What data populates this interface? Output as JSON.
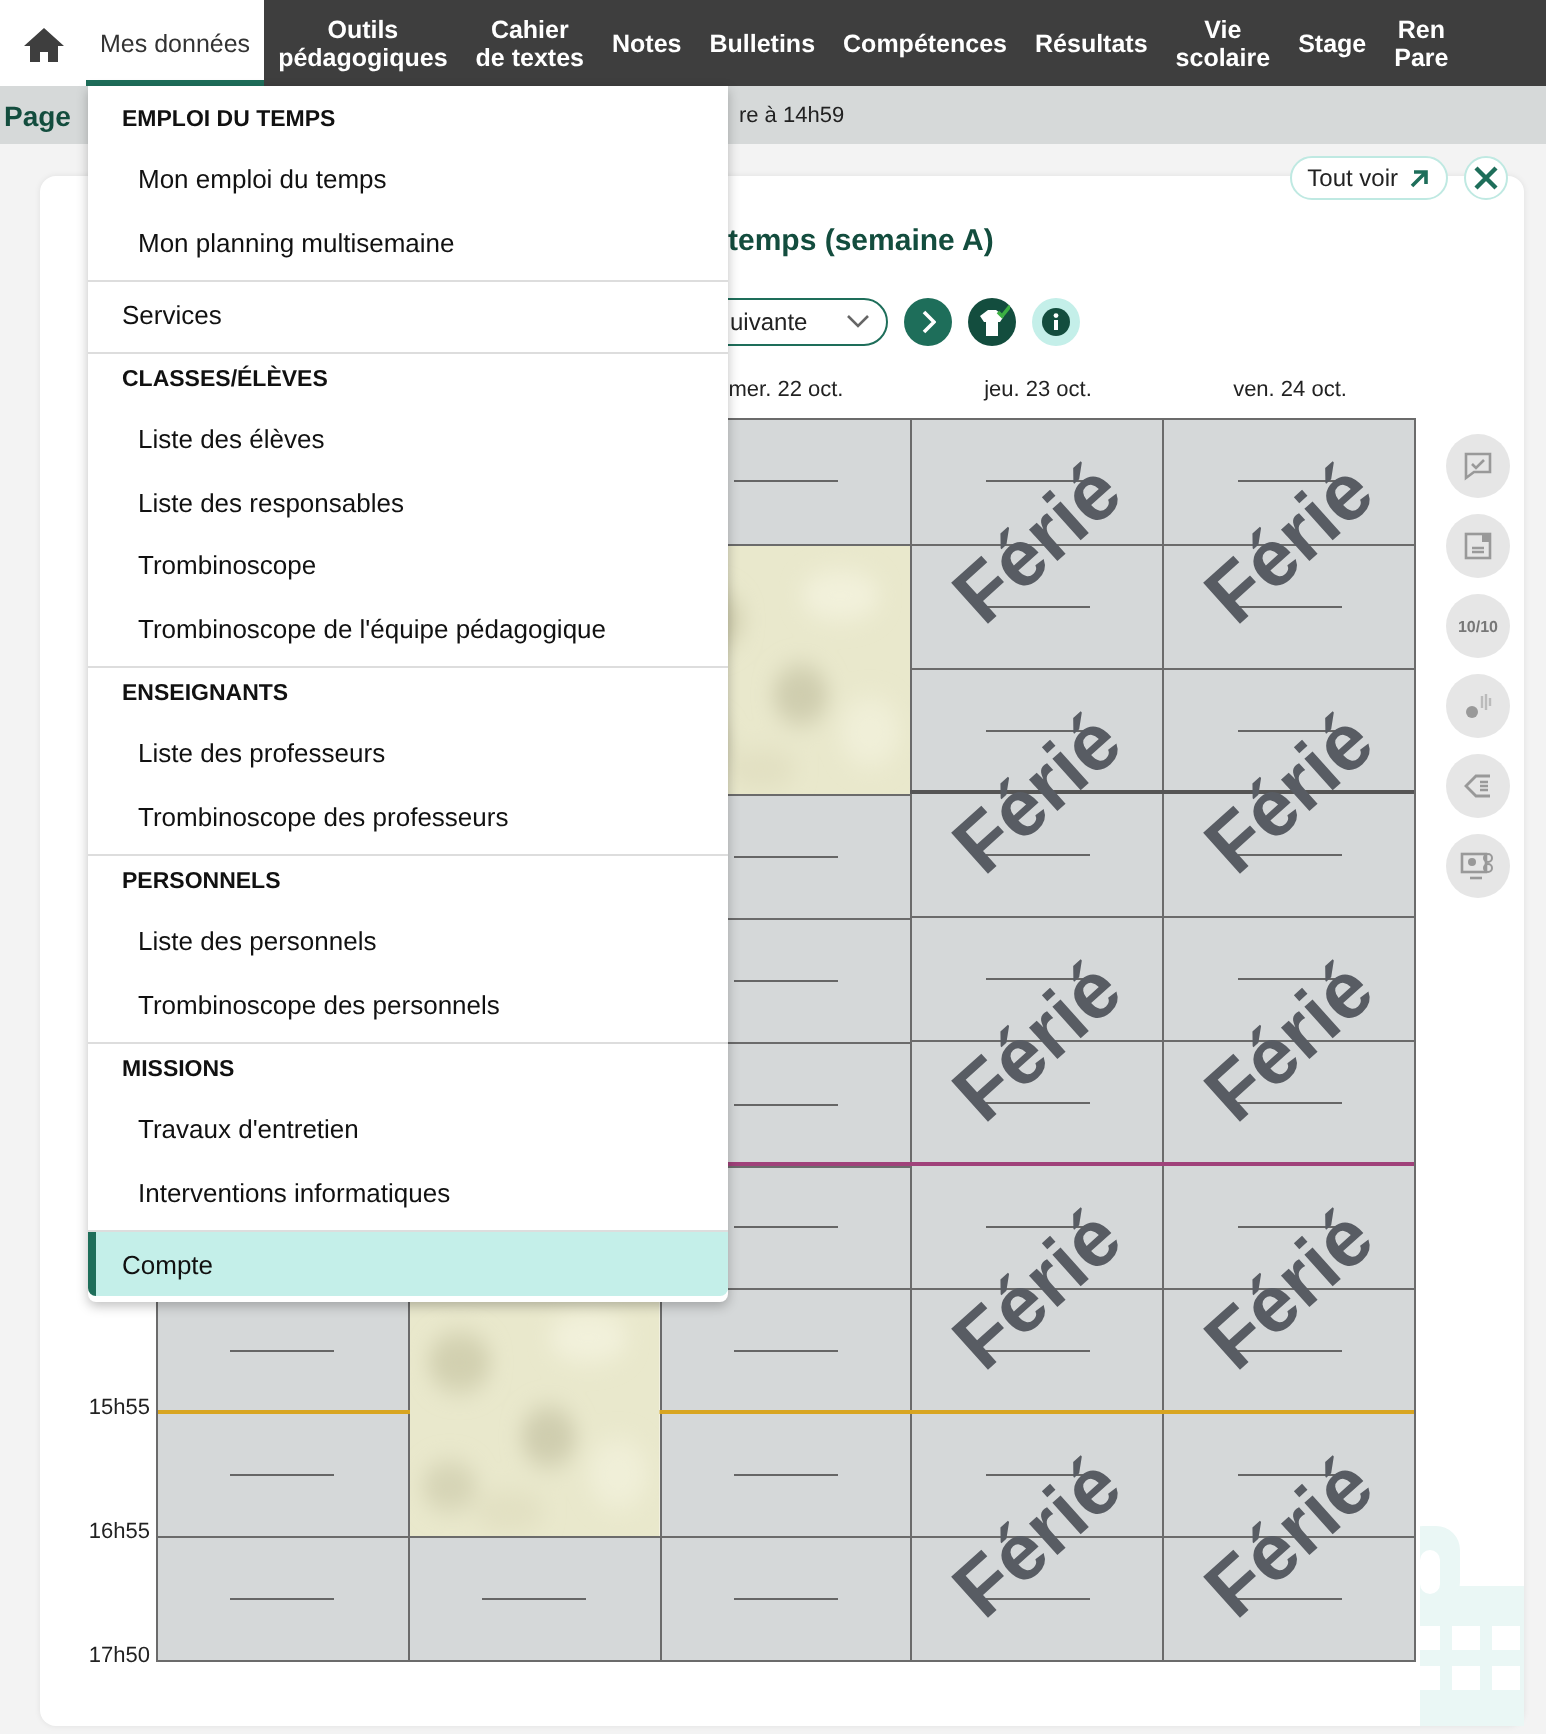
{
  "nav": {
    "tabs": [
      {
        "label": "Mes données",
        "selected": true
      },
      {
        "label": "Outils\npédagogiques",
        "selected": false
      },
      {
        "label": "Cahier\nde textes",
        "selected": false
      },
      {
        "label": "Notes",
        "selected": false
      },
      {
        "label": "Bulletins",
        "selected": false
      },
      {
        "label": "Compétences",
        "selected": false
      },
      {
        "label": "Résultats",
        "selected": false
      },
      {
        "label": "Vie\nscolaire",
        "selected": false
      },
      {
        "label": "Stage",
        "selected": false
      },
      {
        "label": "Ren\nPare",
        "selected": false
      }
    ]
  },
  "subheader": {
    "title": "Page",
    "info": "re à 14h59"
  },
  "menu": [
    {
      "kind": "group",
      "header": "EMPLOI DU TEMPS",
      "items": [
        {
          "label": "Mon emploi du temps",
          "selected": false
        },
        {
          "label": "Mon planning multisemaine",
          "selected": false
        }
      ]
    },
    {
      "kind": "link",
      "label": "Services",
      "selected": false
    },
    {
      "kind": "group",
      "header": "CLASSES/ÉLÈVES",
      "items": [
        {
          "label": "Liste des élèves",
          "selected": false
        },
        {
          "label": "Liste des responsables",
          "selected": false
        },
        {
          "label": "Trombinoscope",
          "selected": false
        },
        {
          "label": "Trombinoscope de l'équipe pédagogique",
          "selected": false
        }
      ]
    },
    {
      "kind": "group",
      "header": "ENSEIGNANTS",
      "items": [
        {
          "label": "Liste des professeurs",
          "selected": false
        },
        {
          "label": "Trombinoscope des professeurs",
          "selected": false
        }
      ]
    },
    {
      "kind": "group",
      "header": "PERSONNELS",
      "items": [
        {
          "label": "Liste des personnels",
          "selected": false
        },
        {
          "label": "Trombinoscope des personnels",
          "selected": false
        }
      ]
    },
    {
      "kind": "group",
      "header": "MISSIONS",
      "items": [
        {
          "label": "Travaux d'entretien",
          "selected": false
        },
        {
          "label": "Interventions informatiques",
          "selected": false
        }
      ]
    },
    {
      "kind": "link",
      "label": "Compte",
      "selected": true
    }
  ],
  "panel": {
    "see_all": "Tout voir",
    "title": "temps (semaine A)",
    "week_select": "uivante",
    "tools": [
      {
        "kind": "comment"
      },
      {
        "kind": "note"
      },
      {
        "kind": "grade",
        "label": "10/10"
      },
      {
        "kind": "sound"
      },
      {
        "kind": "tag"
      },
      {
        "kind": "screen"
      }
    ],
    "timetable": {
      "end_time": "17h50",
      "rows": [
        {},
        {},
        {},
        {
          "color": "#555555"
        },
        {},
        {},
        {
          "color": "#a0417a"
        },
        {},
        {
          "color": "#d8a521",
          "time": "15h55"
        },
        {
          "time": "16h55"
        }
      ],
      "columns": [
        {
          "slots": [
            {
              "kind": "hidden"
            },
            {
              "kind": "hidden"
            },
            {
              "kind": "hidden"
            },
            {
              "kind": "hidden"
            },
            {
              "kind": "hidden"
            },
            {
              "kind": "hidden"
            },
            {
              "kind": "hidden"
            },
            {
              "kind": "free"
            },
            {
              "kind": "free"
            },
            {
              "kind": "free"
            }
          ]
        },
        {
          "slots": [
            {
              "kind": "hidden"
            },
            {
              "kind": "hidden"
            },
            {
              "kind": "hidden"
            },
            {
              "kind": "hidden"
            },
            {
              "kind": "hidden"
            },
            {
              "kind": "hidden"
            },
            {
              "kind": "hidden"
            },
            {
              "kind": "picture"
            },
            {
              "kind": "picture"
            },
            {
              "kind": "free"
            }
          ]
        },
        {
          "header": "mer. 22 oct.",
          "slots": [
            {
              "kind": "free"
            },
            {
              "kind": "picture"
            },
            {
              "kind": "picture"
            },
            {
              "kind": "free"
            },
            {
              "kind": "free"
            },
            {
              "kind": "free"
            },
            {
              "kind": "free"
            },
            {
              "kind": "free"
            },
            {
              "kind": "free"
            },
            {
              "kind": "free"
            }
          ]
        },
        {
          "header": "jeu. 23 oct.",
          "holiday": [
            "Férié",
            "Férié",
            "Férié",
            "Férié",
            "Férié"
          ],
          "slots": [
            {
              "kind": "free"
            },
            {
              "kind": "free"
            },
            {
              "kind": "free"
            },
            {
              "kind": "free"
            },
            {
              "kind": "free"
            },
            {
              "kind": "free"
            },
            {
              "kind": "free"
            },
            {
              "kind": "free"
            },
            {
              "kind": "free"
            },
            {
              "kind": "free"
            }
          ]
        },
        {
          "header": "ven. 24 oct.",
          "holiday": [
            "Férié",
            "Férié",
            "Férié",
            "Férié",
            "Férié"
          ],
          "slots": [
            {
              "kind": "free"
            },
            {
              "kind": "free"
            },
            {
              "kind": "free"
            },
            {
              "kind": "free"
            },
            {
              "kind": "free"
            },
            {
              "kind": "free"
            },
            {
              "kind": "free"
            },
            {
              "kind": "free"
            },
            {
              "kind": "free"
            },
            {
              "kind": "free"
            }
          ]
        }
      ]
    }
  }
}
